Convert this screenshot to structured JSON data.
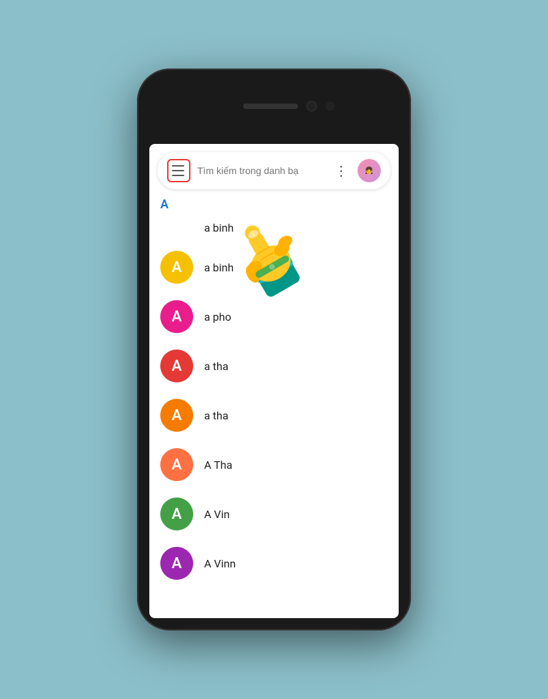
{
  "phone": {
    "background": "#8bbfc9"
  },
  "searchBar": {
    "placeholder": "Tìm kiếm trong danh bạ",
    "menuLabel": "Menu",
    "moreLabel": "More options"
  },
  "sectionLetter": "A",
  "contacts": [
    {
      "id": 1,
      "name": "a binh",
      "avatarLetter": null,
      "avatarColor": null,
      "noAvatar": true
    },
    {
      "id": 2,
      "name": "a binh",
      "avatarLetter": "A",
      "avatarColor": "#f5c000"
    },
    {
      "id": 3,
      "name": "a pho",
      "avatarLetter": "A",
      "avatarColor": "#e91e8c"
    },
    {
      "id": 4,
      "name": "a tha",
      "avatarLetter": "A",
      "avatarColor": "#e53935"
    },
    {
      "id": 5,
      "name": "a tha",
      "avatarLetter": "A",
      "avatarColor": "#f57c00"
    },
    {
      "id": 6,
      "name": "A Tha",
      "avatarLetter": "A",
      "avatarColor": "#ff7043"
    },
    {
      "id": 7,
      "name": "A Vin",
      "avatarLetter": "A",
      "avatarColor": "#43a047"
    },
    {
      "id": 8,
      "name": "A Vinn",
      "avatarLetter": "A",
      "avatarColor": "#9c27b0"
    }
  ]
}
